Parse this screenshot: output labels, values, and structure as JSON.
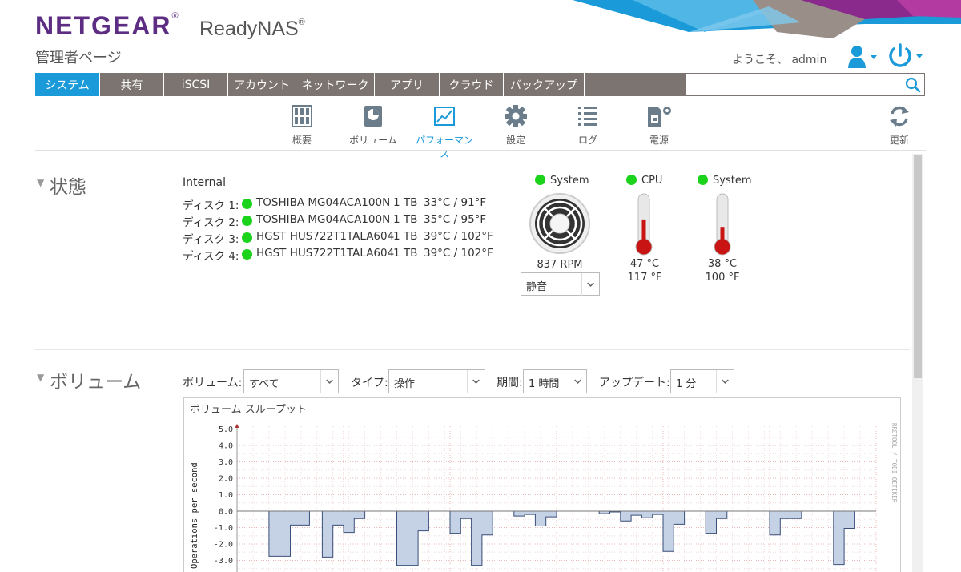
{
  "header": {
    "brand": "NETGEAR",
    "brand_mark": "®",
    "product": "ReadyNAS",
    "product_mark": "®",
    "subtitle": "管理者ページ",
    "welcome": "ようこそ、 admin",
    "accent": "#1a9ad9",
    "brand_color": "#5c2d82"
  },
  "nav": {
    "tabs": [
      {
        "label": "システム",
        "active": true
      },
      {
        "label": "共有"
      },
      {
        "label": "iSCSI"
      },
      {
        "label": "アカウント"
      },
      {
        "label": "ネットワーク"
      },
      {
        "label": "アプリ"
      },
      {
        "label": "クラウド"
      },
      {
        "label": "バックアップ"
      }
    ],
    "search_placeholder": ""
  },
  "subnav": {
    "items": [
      {
        "label": "概要",
        "icon": "overview-icon"
      },
      {
        "label": "ボリューム",
        "icon": "volume-icon"
      },
      {
        "label": "パフォーマンス",
        "icon": "performance-icon",
        "active": true
      },
      {
        "label": "設定",
        "icon": "gear-icon"
      },
      {
        "label": "ログ",
        "icon": "log-icon"
      },
      {
        "label": "電源",
        "icon": "power-settings-icon"
      }
    ],
    "refresh_label": "更新"
  },
  "status": {
    "title": "状態",
    "internal_label": "Internal",
    "disks": [
      {
        "label": "ディスク 1:",
        "model": "TOSHIBA MG04ACA100N",
        "size": "1 TB",
        "temp": "33°C / 91°F"
      },
      {
        "label": "ディスク 2:",
        "model": "TOSHIBA MG04ACA100N",
        "size": "1 TB",
        "temp": "35°C / 95°F"
      },
      {
        "label": "ディスク 3:",
        "model": "HGST HUS722T1TALA604",
        "size": "1 TB",
        "temp": "39°C / 102°F"
      },
      {
        "label": "ディスク 4:",
        "model": "HGST HUS722T1TALA604",
        "size": "1 TB",
        "temp": "39°C / 102°F"
      }
    ],
    "fan": {
      "label": "System",
      "rpm": "837 RPM",
      "mode": "静音"
    },
    "cpu": {
      "label": "CPU",
      "temp_c": "47 °C",
      "temp_f": "117 °F",
      "level": 0.55
    },
    "system": {
      "label": "System",
      "temp_c": "38 °C",
      "temp_f": "100 °F",
      "level": 0.4
    },
    "ok_color": "#1ad31a"
  },
  "volume": {
    "title": "ボリューム",
    "filters": {
      "volume_label": "ボリューム:",
      "volume_value": "すべて",
      "type_label": "タイプ:",
      "type_value": "操作",
      "period_label": "期間:",
      "period_value": "1 時間",
      "update_label": "アップデート:",
      "update_value": "1 分"
    },
    "chart_title": "ボリューム スループット"
  },
  "chart_data": {
    "type": "area",
    "title": "ボリューム スループット",
    "ylabel": "Operations per second",
    "watermark": "RRDTOOL / TOBI OETIKER",
    "yticks": [
      "5.0",
      "4.0",
      "3.0",
      "2.0",
      "1.0",
      "0.0",
      "-1.0",
      "-2.0",
      "-3.0"
    ],
    "ylim_visible": [
      -3.3,
      5.3
    ],
    "x_unit_minutes": [
      0,
      60
    ],
    "series": [
      {
        "points": [
          [
            0.0,
            0
          ],
          [
            3.0,
            0
          ],
          [
            3.0,
            -2.75
          ],
          [
            5.0,
            -2.75
          ],
          [
            5.0,
            -0.85
          ],
          [
            6.8,
            -0.85
          ],
          [
            6.8,
            0
          ],
          [
            8.0,
            0
          ],
          [
            8.0,
            -2.8
          ],
          [
            9.0,
            -2.8
          ],
          [
            9.0,
            -0.85
          ],
          [
            10.0,
            -0.85
          ],
          [
            10.0,
            -1.3
          ],
          [
            11.0,
            -1.3
          ],
          [
            11.0,
            -0.45
          ],
          [
            12.0,
            -0.45
          ],
          [
            12.0,
            0
          ],
          [
            15.0,
            0
          ],
          [
            15.0,
            -3.3
          ],
          [
            17.0,
            -3.3
          ],
          [
            17.0,
            -1.2
          ],
          [
            18.0,
            -1.2
          ],
          [
            18.0,
            0
          ],
          [
            20.0,
            0
          ],
          [
            20.0,
            -1.35
          ],
          [
            21.0,
            -1.35
          ],
          [
            21.0,
            -0.45
          ],
          [
            22.0,
            -0.45
          ],
          [
            22.0,
            -3.3
          ],
          [
            23.0,
            -3.3
          ],
          [
            23.0,
            -1.45
          ],
          [
            24.0,
            -1.45
          ],
          [
            24.0,
            0
          ],
          [
            26.0,
            0
          ],
          [
            26.0,
            -0.3
          ],
          [
            27.0,
            -0.3
          ],
          [
            27.0,
            -0.2
          ],
          [
            28.0,
            -0.2
          ],
          [
            28.0,
            -0.9
          ],
          [
            29.0,
            -0.9
          ],
          [
            29.0,
            -0.35
          ],
          [
            30.0,
            -0.35
          ],
          [
            30.0,
            0
          ],
          [
            34.0,
            0
          ],
          [
            34.0,
            -0.15
          ],
          [
            35.0,
            -0.15
          ],
          [
            35.0,
            -0.05
          ],
          [
            36.0,
            -0.05
          ],
          [
            36.0,
            -0.6
          ],
          [
            37.0,
            -0.6
          ],
          [
            37.0,
            -0.25
          ],
          [
            38.0,
            -0.25
          ],
          [
            38.0,
            -0.4
          ],
          [
            39.0,
            -0.4
          ],
          [
            39.0,
            -0.2
          ],
          [
            40.0,
            -0.2
          ],
          [
            40.0,
            -2.45
          ],
          [
            41.0,
            -2.45
          ],
          [
            41.0,
            -0.8
          ],
          [
            42.0,
            -0.8
          ],
          [
            42.0,
            0
          ],
          [
            44.0,
            0
          ],
          [
            44.0,
            -1.35
          ],
          [
            45.0,
            -1.35
          ],
          [
            45.0,
            -0.45
          ],
          [
            46.0,
            -0.45
          ],
          [
            46.0,
            0
          ],
          [
            50.0,
            0
          ],
          [
            50.0,
            -1.45
          ],
          [
            51.0,
            -1.45
          ],
          [
            51.0,
            -0.45
          ],
          [
            53.0,
            -0.45
          ],
          [
            53.0,
            0
          ],
          [
            56.0,
            0
          ],
          [
            56.0,
            -3.25
          ],
          [
            57.0,
            -3.25
          ],
          [
            57.0,
            -1.05
          ],
          [
            58.0,
            -1.05
          ],
          [
            58.0,
            0
          ],
          [
            60.0,
            0
          ]
        ]
      }
    ]
  }
}
